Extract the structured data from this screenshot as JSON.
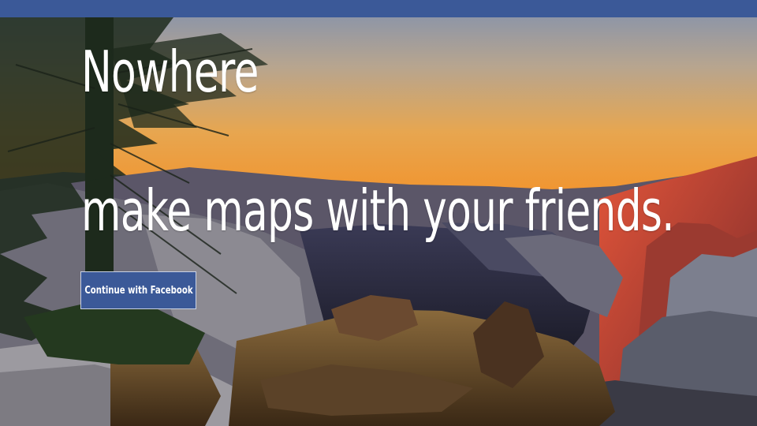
{
  "app": {
    "title": "Nowhere",
    "tagline": "make maps with your friends."
  },
  "auth": {
    "facebook_button_label": "Continue with Facebook"
  },
  "colors": {
    "top_bar": "#3b5998",
    "button": "#3b5998",
    "text": "#ffffff"
  },
  "background": {
    "icon": "mountain-sunset-photo"
  }
}
